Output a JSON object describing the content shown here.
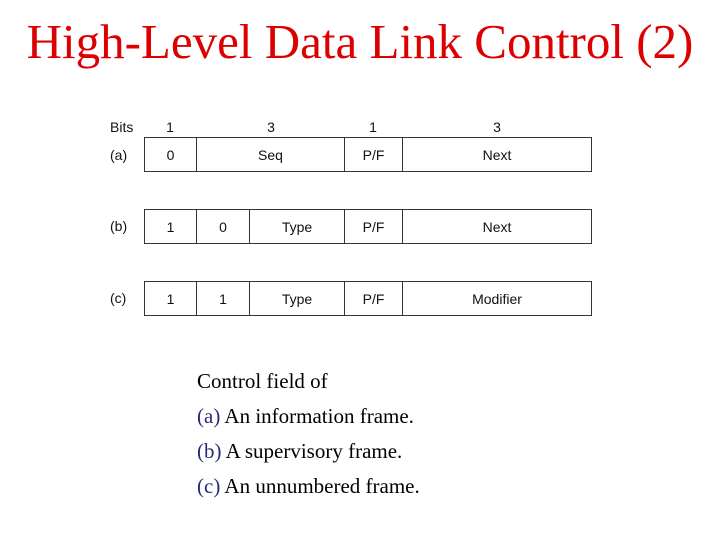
{
  "title": "High-Level Data Link Control (2)",
  "figure": {
    "bits_label": "Bits",
    "bit_widths": [
      "1",
      "3",
      "1",
      "3"
    ],
    "rows": [
      {
        "label": "(a)",
        "cells": [
          "0",
          "Seq",
          "P/F",
          "Next"
        ]
      },
      {
        "label": "(b)",
        "cells": [
          "1",
          "0",
          "Type",
          "P/F",
          "Next"
        ]
      },
      {
        "label": "(c)",
        "cells": [
          "1",
          "1",
          "Type",
          "P/F",
          "Modifier"
        ]
      }
    ]
  },
  "caption": {
    "heading": "Control field of",
    "items": [
      {
        "prefix": "(a)",
        "text": " An information frame."
      },
      {
        "prefix": "(b)",
        "text": " A supervisory frame."
      },
      {
        "prefix": "(c)",
        "text": " An unnumbered frame."
      }
    ]
  }
}
